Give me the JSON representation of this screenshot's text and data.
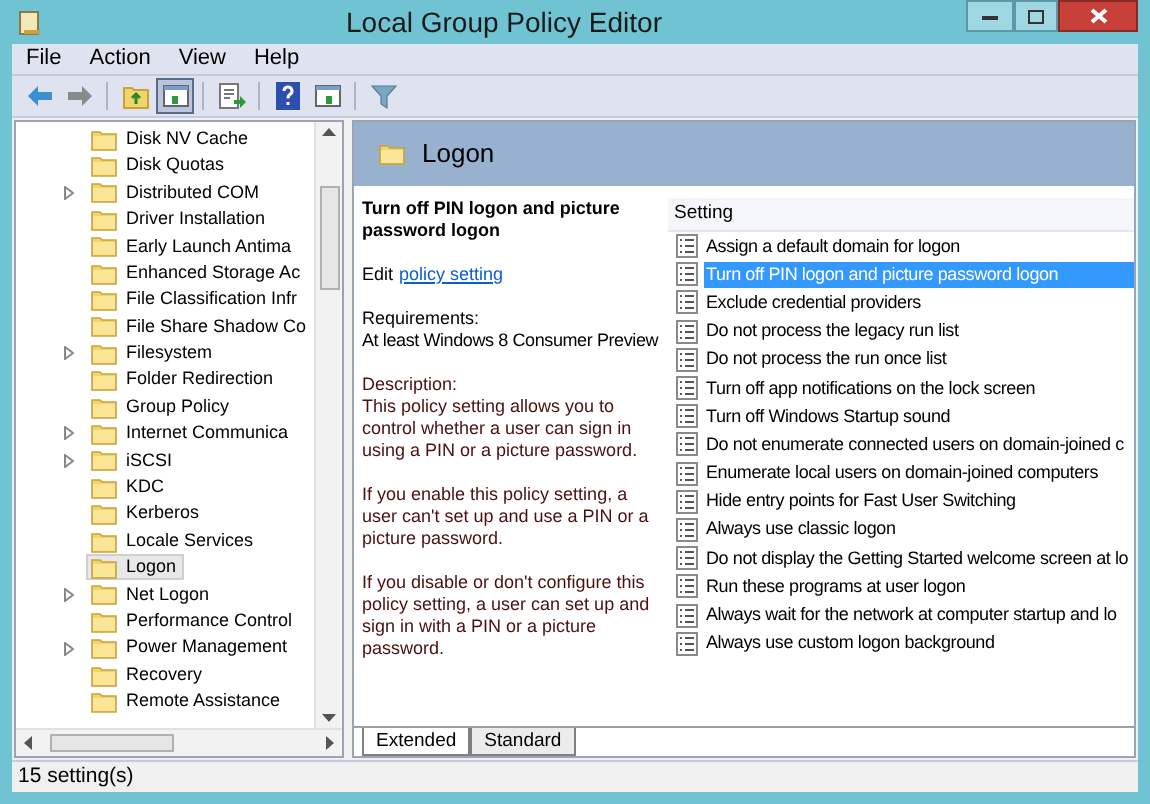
{
  "window": {
    "title": "Local Group Policy Editor"
  },
  "menu": [
    "File",
    "Action",
    "View",
    "Help"
  ],
  "toolbar": [
    [
      {
        "kind": "back",
        "pressed": false
      },
      {
        "kind": "forward",
        "pressed": false
      }
    ],
    [
      {
        "kind": "up",
        "pressed": false
      },
      {
        "kind": "tree",
        "pressed": true
      }
    ],
    [
      {
        "kind": "export",
        "pressed": false
      }
    ],
    [
      {
        "kind": "help",
        "pressed": false
      },
      {
        "kind": "pane",
        "pressed": false
      }
    ],
    [
      {
        "kind": "filter",
        "pressed": false
      }
    ]
  ],
  "tree": [
    {
      "name": "Disk NV Cache",
      "expandable": false,
      "selected": false
    },
    {
      "name": "Disk Quotas",
      "expandable": false,
      "selected": false
    },
    {
      "name": "Distributed COM",
      "expandable": true,
      "selected": false
    },
    {
      "name": "Driver Installation",
      "expandable": false,
      "selected": false
    },
    {
      "name": "Early Launch Antima",
      "expandable": false,
      "selected": false
    },
    {
      "name": "Enhanced Storage Ac",
      "expandable": false,
      "selected": false
    },
    {
      "name": "File Classification Infr",
      "expandable": false,
      "selected": false
    },
    {
      "name": "File Share Shadow Co",
      "expandable": false,
      "selected": false
    },
    {
      "name": "Filesystem",
      "expandable": true,
      "selected": false
    },
    {
      "name": "Folder Redirection",
      "expandable": false,
      "selected": false
    },
    {
      "name": "Group Policy",
      "expandable": false,
      "selected": false
    },
    {
      "name": "Internet Communica",
      "expandable": true,
      "selected": false
    },
    {
      "name": "iSCSI",
      "expandable": true,
      "selected": false
    },
    {
      "name": "KDC",
      "expandable": false,
      "selected": false
    },
    {
      "name": "Kerberos",
      "expandable": false,
      "selected": false
    },
    {
      "name": "Locale Services",
      "expandable": false,
      "selected": false
    },
    {
      "name": "Logon",
      "expandable": false,
      "selected": true
    },
    {
      "name": "Net Logon",
      "expandable": true,
      "selected": false
    },
    {
      "name": "Performance Control",
      "expandable": false,
      "selected": false
    },
    {
      "name": "Power Management",
      "expandable": true,
      "selected": false
    },
    {
      "name": "Recovery",
      "expandable": false,
      "selected": false
    },
    {
      "name": "Remote Assistance",
      "expandable": false,
      "selected": false
    }
  ],
  "detail": {
    "heading": "Logon",
    "policy_title": "Turn off PIN logon and picture password logon",
    "edit_prefix": "Edit",
    "edit_link": "policy setting",
    "requirements_label": "Requirements:",
    "requirements": "At least Windows 8 Consumer Preview",
    "description_label": "Description:",
    "paragraphs": [
      "This policy setting allows you to control whether a user can sign in using a PIN or a picture password.",
      "If you enable this policy setting, a user can't set up and use a PIN or a picture password.",
      "If you disable or don't configure this policy setting, a user can set up and sign in with a PIN or a picture password."
    ]
  },
  "settings": {
    "column": "Setting",
    "rows": [
      {
        "name": "Assign a default domain for logon",
        "selected": false
      },
      {
        "name": "Turn off PIN logon and picture password logon",
        "selected": true
      },
      {
        "name": "Exclude credential providers",
        "selected": false
      },
      {
        "name": "Do not process the legacy run list",
        "selected": false
      },
      {
        "name": "Do not process the run once list",
        "selected": false
      },
      {
        "name": "Turn off app notifications on the lock screen",
        "selected": false
      },
      {
        "name": "Turn off Windows Startup sound",
        "selected": false
      },
      {
        "name": "Do not enumerate connected users on domain-joined c",
        "selected": false
      },
      {
        "name": "Enumerate local users on domain-joined computers",
        "selected": false
      },
      {
        "name": "Hide entry points for Fast User Switching",
        "selected": false
      },
      {
        "name": "Always use classic logon",
        "selected": false
      },
      {
        "name": "Do not display the Getting Started welcome screen at lo",
        "selected": false
      },
      {
        "name": "Run these programs at user logon",
        "selected": false
      },
      {
        "name": "Always wait for the network at computer startup and lo",
        "selected": false
      },
      {
        "name": "Always use custom logon background",
        "selected": false
      }
    ]
  },
  "tabs": [
    {
      "label": "Extended",
      "selected": true
    },
    {
      "label": "Standard",
      "selected": false
    }
  ],
  "status_bar": "15 setting(s)"
}
